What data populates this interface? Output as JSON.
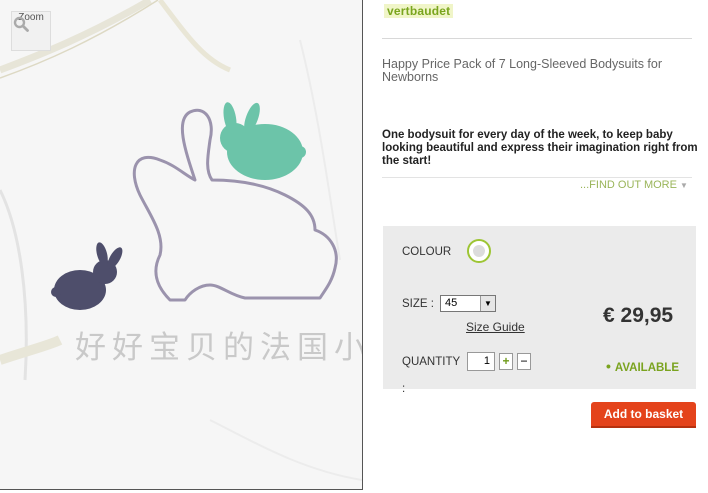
{
  "image_panel": {
    "zoom_label": "Zoom",
    "watermark": "好好宝贝的法国小铺"
  },
  "brand": "vertbaudet",
  "product": {
    "title": "Happy Price Pack of 7 Long-Sleeved Bodysuits for Newborns",
    "description": "One bodysuit for every day of the week, to keep baby looking beautiful and express their imagination right from the start!",
    "find_more": "...FIND OUT MORE"
  },
  "options": {
    "colour_label": "COLOUR",
    "size_label": "SIZE :",
    "size_value": "45",
    "size_guide": "Size Guide",
    "price": "€ 29,95",
    "quantity_label": "QUANTITY",
    "quantity_colon": ":",
    "quantity_value": "1",
    "plus": "+",
    "minus": "−",
    "availability": "AVAILABLE",
    "add_to_basket": "Add to basket"
  },
  "colors": {
    "brand_green": "#7aa51e",
    "button_orange": "#e4431b",
    "swatch_ring": "#9dc534",
    "bunny_mint": "#6cc4a9",
    "bunny_slate": "#4e4e6b"
  }
}
